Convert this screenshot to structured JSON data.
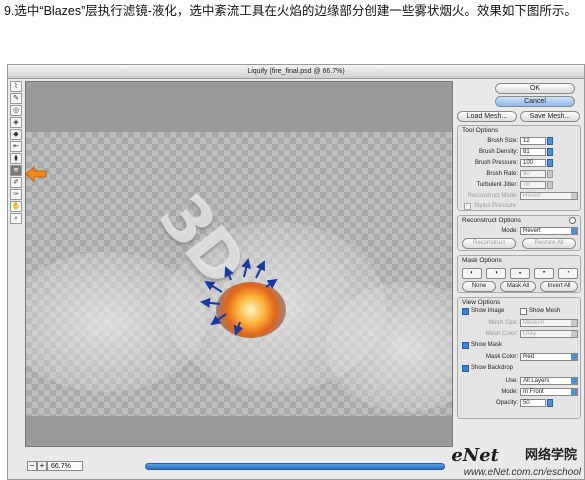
{
  "caption": "9.选中“Blazes”层执行滤镜-液化，选中紊流工具在火焰的边缘部分创建一些雾状烟火。效果如下图所示。",
  "window": {
    "title": "Liquify (fire_final.psd @ 66.7%)"
  },
  "tools": [
    "warp-tool",
    "reconstruct-tool",
    "twirl-tool",
    "pucker-tool",
    "bloat-tool",
    "push-left-tool",
    "mirror-tool",
    "turbulence-tool",
    "freeze-mask-tool",
    "thaw-mask-tool",
    "hand-tool",
    "zoom-tool"
  ],
  "accent_color": "#f28a1e",
  "canvas": {
    "text_art": "3D"
  },
  "status": {
    "zoom": "66.7%",
    "minus": "−",
    "plus": "+"
  },
  "buttons": {
    "ok": "OK",
    "cancel": "Cancel",
    "load_mesh": "Load Mesh...",
    "save_mesh": "Save Mesh..."
  },
  "tool_options": {
    "title": "Tool Options",
    "brush_size": {
      "label": "Brush Size:",
      "value": "12"
    },
    "brush_density": {
      "label": "Brush Density:",
      "value": "81"
    },
    "brush_pressure": {
      "label": "Brush Pressure:",
      "value": "100"
    },
    "brush_rate": {
      "label": "Brush Rate:",
      "value": "80"
    },
    "turbulent_jitter": {
      "label": "Turbulent Jitter:",
      "value": "78"
    },
    "reconstruct_mode": {
      "label": "Reconstruct Mode:",
      "value": "Revert"
    },
    "stylus_pressure": "Stylus Pressure"
  },
  "reconstruct_options": {
    "title": "Reconstruct Options",
    "mode_label": "Mode:",
    "mode_value": "Revert",
    "reconstruct": "Reconstruct",
    "restore_all": "Restore All"
  },
  "mask_options": {
    "title": "Mask Options",
    "none": "None",
    "mask_all": "Mask All",
    "invert_all": "Invert All"
  },
  "view_options": {
    "title": "View Options",
    "show_image": "Show Image",
    "show_mesh": "Show Mesh",
    "mesh_size": {
      "label": "Mesh Size:",
      "value": "Medium"
    },
    "mesh_color": {
      "label": "Mesh Color:",
      "value": "Gray"
    },
    "show_mask": "Show Mask",
    "mask_color": {
      "label": "Mask Color:",
      "value": "Red"
    },
    "show_backdrop": "Show Backdrop",
    "use": {
      "label": "Use:",
      "value": "All Layers"
    },
    "mode": {
      "label": "Mode:",
      "value": "In Front"
    },
    "opacity": {
      "label": "Opacity:",
      "value": "50"
    }
  },
  "watermark": {
    "logo": "eNet",
    "logo_cn": "网络学院",
    "url": "www.eNet.com.cn/eschool"
  }
}
